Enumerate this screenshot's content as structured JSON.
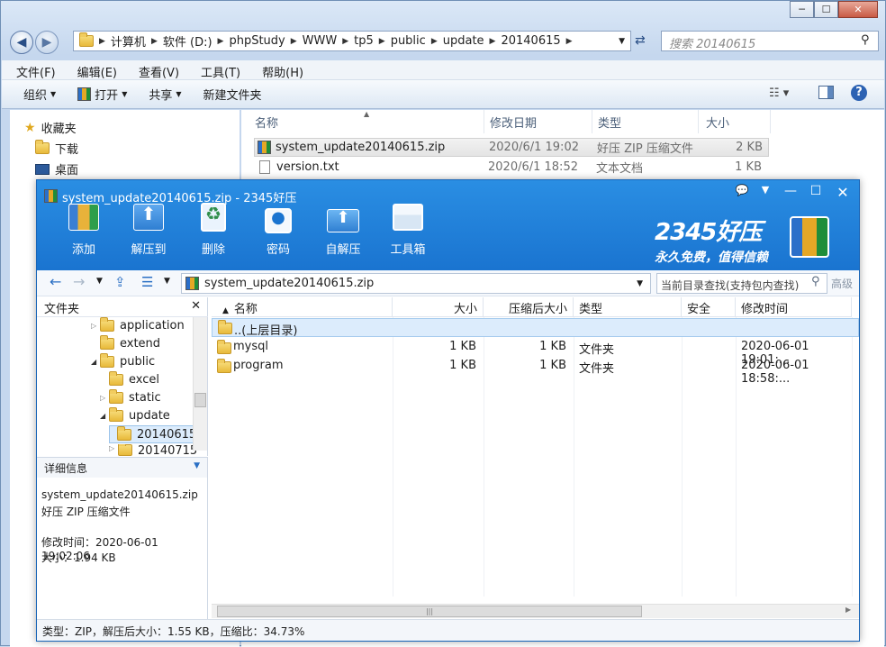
{
  "explorer": {
    "address": [
      "计算机",
      "软件 (D:)",
      "phpStudy",
      "WWW",
      "tp5",
      "public",
      "update",
      "20140615"
    ],
    "search_placeholder": "搜索 20140615",
    "menu": [
      "文件(F)",
      "编辑(E)",
      "查看(V)",
      "工具(T)",
      "帮助(H)"
    ],
    "toolbar": {
      "organize": "组织",
      "open": "打开",
      "share": "共享",
      "new_folder": "新建文件夹"
    },
    "nav": {
      "favorites": "收藏夹",
      "downloads": "下载",
      "desktop": "桌面"
    },
    "columns": {
      "name": "名称",
      "modified": "修改日期",
      "type": "类型",
      "size": "大小"
    },
    "files": [
      {
        "name": "system_update20140615.zip",
        "modified": "2020/6/1 19:02",
        "type": "好压 ZIP 压缩文件",
        "size": "2 KB"
      },
      {
        "name": "version.txt",
        "modified": "2020/6/1 18:52",
        "type": "文本文档",
        "size": "1 KB"
      }
    ]
  },
  "zip": {
    "title": "system_update20140615.zip - 2345好压",
    "tools": [
      "添加",
      "解压到",
      "删除",
      "密码",
      "自解压",
      "工具箱"
    ],
    "brand": {
      "logo": "2345好压",
      "slogan": "永久免费，值得信赖"
    },
    "address": "system_update20140615.zip",
    "search_placeholder": "当前目录查找(支持包内查找)",
    "search_advanced": "高级",
    "folder_pane_title": "文件夹",
    "tree": [
      {
        "label": "application"
      },
      {
        "label": "extend"
      },
      {
        "label": "public"
      },
      {
        "label": "excel"
      },
      {
        "label": "static"
      },
      {
        "label": "update"
      },
      {
        "label": "20140615"
      },
      {
        "label": "20140715"
      }
    ],
    "details": {
      "title": "详细信息",
      "filename": "system_update20140615.zip",
      "filetype": "好压 ZIP 压缩文件",
      "modified": "修改时间：2020-06-01 19:02:06",
      "size": "大小：1.94 KB"
    },
    "columns": {
      "name": "名称",
      "size": "大小",
      "packed": "压缩后大小",
      "type": "类型",
      "security": "安全",
      "modified": "修改时间"
    },
    "parent_row": "..(上层目录)",
    "rows": [
      {
        "name": "mysql",
        "size": "1 KB",
        "packed": "1 KB",
        "type": "文件夹",
        "modified": "2020-06-01 19:01:..."
      },
      {
        "name": "program",
        "size": "1 KB",
        "packed": "1 KB",
        "type": "文件夹",
        "modified": "2020-06-01 18:58:..."
      }
    ],
    "status": "类型：ZIP，解压后大小：1.55 KB，压缩比：34.73%"
  }
}
